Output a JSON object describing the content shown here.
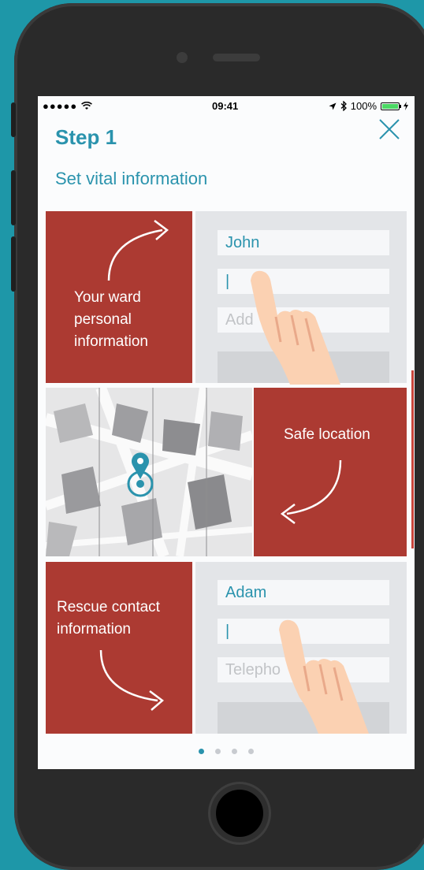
{
  "status_bar": {
    "signal": "●●●●● ",
    "wifi": "wifi-icon",
    "time": "09:41",
    "location": "location-arrow-icon",
    "bluetooth": "bluetooth-icon",
    "battery_text": "100%",
    "battery_level": 1.0
  },
  "header": {
    "title": "Step 1",
    "subtitle": "Set vital information",
    "close_icon": "close-icon"
  },
  "panel_personal": {
    "label": "Your ward personal information",
    "fields": [
      {
        "value": "John"
      },
      {
        "value": "|"
      },
      {
        "value": "Add"
      }
    ]
  },
  "panel_location": {
    "label": "Safe location",
    "map_pin_icon": "map-pin-icon"
  },
  "panel_rescue": {
    "label": "Rescue contact information",
    "fields": [
      {
        "value": "Adam"
      },
      {
        "value": "|"
      },
      {
        "value": "Telepho"
      }
    ]
  },
  "pagination": {
    "count": 4,
    "active_index": 0
  },
  "colors": {
    "background": "#1e97a8",
    "accent": "#2a93ad",
    "card_red": "#ac3a32",
    "skin": "#fbd1b2"
  }
}
